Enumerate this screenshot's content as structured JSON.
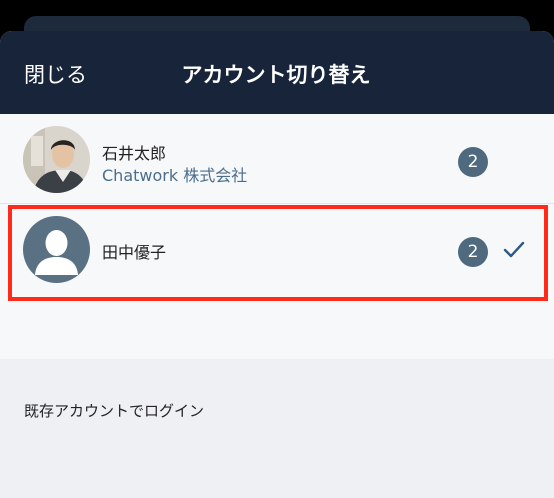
{
  "header": {
    "close_label": "閉じる",
    "title": "アカウント切り替え"
  },
  "accounts": [
    {
      "name": "石井太郎",
      "organization": "Chatwork 株式会社",
      "badge": "2",
      "avatar": "user-photo",
      "selected": false
    },
    {
      "name": "田中優子",
      "organization": "",
      "badge": "2",
      "avatar": "default-person-icon",
      "selected": true
    }
  ],
  "login_existing_label": "既存アカウントでログイン",
  "colors": {
    "header_bg": "#17243a",
    "badge_bg": "#4f6a7e",
    "link_blue": "#4a6e8c",
    "highlight_red": "#ff2a1a",
    "check": "#2f5a86"
  },
  "icons": {
    "selected_check": "checkmark-icon",
    "default_avatar": "person-silhouette-icon"
  }
}
